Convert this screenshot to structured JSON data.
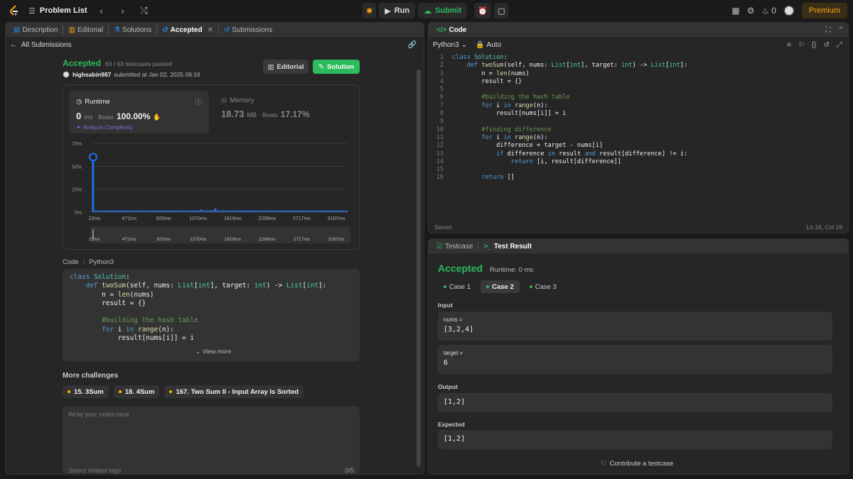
{
  "topbar": {
    "title": "Problem List",
    "run_label": "Run",
    "submit_label": "Submit",
    "streak_count": "0",
    "premium_label": "Premium"
  },
  "left_tabs": [
    {
      "label": "Description"
    },
    {
      "label": "Editorial"
    },
    {
      "label": "Solutions"
    },
    {
      "label": "Accepted"
    },
    {
      "label": "Submissions"
    }
  ],
  "all_submissions_label": "All Submissions",
  "result": {
    "status": "Accepted",
    "testcases": "63 / 63 testcases passed",
    "username": "highsabin987",
    "submitted_text": "submitted at Jan 02, 2025 09:16",
    "editorial_button": "Editorial",
    "solution_button": "Solution"
  },
  "runtime": {
    "title": "Runtime",
    "value": "0",
    "unit": "ms",
    "beats_label": "Beats",
    "beats_value": "100.00%",
    "analyze_label": "Analyze Complexity"
  },
  "memory": {
    "title": "Memory",
    "value": "18.73",
    "unit": "MB",
    "beats_label": "Beats",
    "beats_value": "17.17%"
  },
  "chart_data": {
    "type": "bar",
    "y_ticks": [
      "75%",
      "50%",
      "25%",
      "0%"
    ],
    "ylim": [
      0,
      75
    ],
    "x_ticks": [
      "22ms",
      "471ms",
      "920ms",
      "1370ms",
      "1819ms",
      "2268ms",
      "2717ms",
      "3167ms"
    ],
    "values": [
      60,
      2,
      2,
      2,
      2,
      2,
      2,
      2,
      2,
      2,
      2,
      2,
      2,
      2,
      2,
      2,
      2,
      2,
      2,
      2,
      2,
      2,
      2,
      2,
      2,
      2,
      2,
      2,
      2,
      2,
      2,
      2,
      2,
      2,
      2,
      2,
      2,
      2,
      3,
      2,
      2,
      2,
      2,
      4,
      2,
      2,
      2,
      2,
      2,
      2,
      2,
      2,
      2,
      2,
      2,
      2,
      2,
      2,
      2,
      2,
      2,
      2,
      2,
      2,
      2,
      2,
      2,
      2,
      2,
      2,
      2,
      2,
      2,
      2,
      2,
      2,
      2,
      2,
      2,
      2,
      2,
      2,
      2,
      2,
      2,
      2,
      2,
      2,
      2,
      2
    ],
    "highlight_color": "#1a73e8",
    "bar_color": "#2f6fd8"
  },
  "code_section": {
    "title": "Code",
    "language": "Python3",
    "view_more": "View more",
    "lines": [
      "class Solution:",
      "    def twoSum(self, nums: List[int], target: int) -> List[int]:",
      "        n = len(nums)",
      "        result = {}",
      "",
      "        #building the hash table",
      "        for i in range(n):",
      "            result[nums[i]] = i"
    ]
  },
  "more_challenges": {
    "title": "More challenges",
    "items": [
      "15. 3Sum",
      "18. 4Sum",
      "167. Two Sum II - Input Array Is Sorted"
    ]
  },
  "notes": {
    "placeholder": "Write your notes here",
    "tags_placeholder": "Select related tags",
    "tags_count": "0/5"
  },
  "editor": {
    "tab_label": "Code",
    "language": "Python3",
    "auto_label": "Auto",
    "saved_label": "Saved",
    "cursor": "Ln 16, Col 18",
    "lines": [
      "class Solution:",
      "    def twoSum(self, nums: List[int], target: int) -> List[int]:",
      "        n = len(nums)",
      "        result = {}",
      "",
      "        #building the hash table",
      "        for i in range(n):",
      "            result[nums[i]] = i",
      "",
      "        #finding difference",
      "        for i in range(n):",
      "            difference = target - nums[i]",
      "            if difference in result and result[difference] != i:",
      "                return [i, result[difference]]",
      "",
      "        return []"
    ]
  },
  "test_panel": {
    "testcase_tab": "Testcase",
    "result_tab": "Test Result",
    "status": "Accepted",
    "runtime": "Runtime: 0 ms",
    "cases": [
      "Case 1",
      "Case 2",
      "Case 3"
    ],
    "input_label": "Input",
    "nums_label": "nums =",
    "nums_value": "[3,2,4]",
    "target_label": "target =",
    "target_value": "6",
    "output_label": "Output",
    "output_value": "[1,2]",
    "expected_label": "Expected",
    "expected_value": "[1,2]",
    "contribute_label": "Contribute a testcase"
  }
}
